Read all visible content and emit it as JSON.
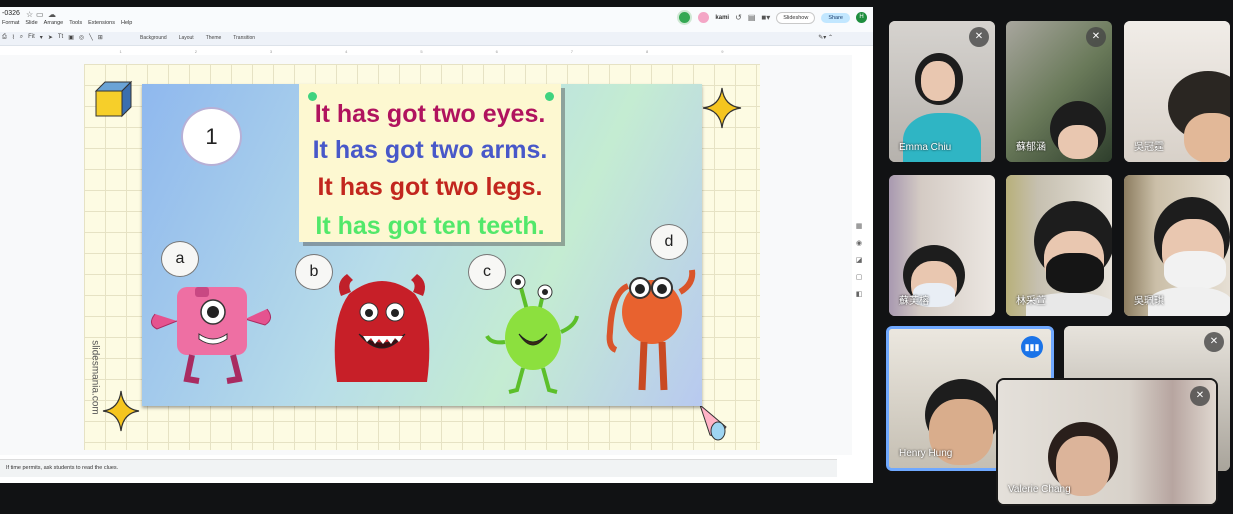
{
  "editor": {
    "title": "-0326",
    "menu": [
      "Format",
      "Slide",
      "Arrange",
      "Tools",
      "Extensions",
      "Help"
    ],
    "kami_label": "kami",
    "slideshow_label": "Slideshow",
    "share_label": "Share",
    "user_initial": "H",
    "zoom_label": "Fit",
    "toolbar_text": [
      "Background",
      "Layout",
      "Theme",
      "Transition"
    ],
    "notes": "If time permits, ask students to read the clues."
  },
  "slide": {
    "number": "1",
    "clues": [
      {
        "text": "It has got two eyes.",
        "color": "#b0135e"
      },
      {
        "text": "It has got two arms.",
        "color": "#4858c9"
      },
      {
        "text": "It has got two legs.",
        "color": "#c2261e"
      },
      {
        "text": "It has got ten teeth.",
        "color": "#52e86a"
      }
    ],
    "labels": [
      "a",
      "b",
      "c",
      "d"
    ],
    "watermark": "slidesmania.com"
  },
  "participants": [
    {
      "name": "Emma Chiu",
      "muted": true
    },
    {
      "name": "蘇郁涵",
      "muted": true
    },
    {
      "name": "吳冠霆",
      "muted": false
    },
    {
      "name": "蘇芙榕",
      "muted": false
    },
    {
      "name": "林采萱",
      "muted": false
    },
    {
      "name": "吳珮琪",
      "muted": false
    },
    {
      "name": "Henry Hung",
      "muted": false,
      "speaking": true
    },
    {
      "name": "",
      "muted": true
    },
    {
      "name": "Valerie Chang",
      "muted": true
    }
  ]
}
